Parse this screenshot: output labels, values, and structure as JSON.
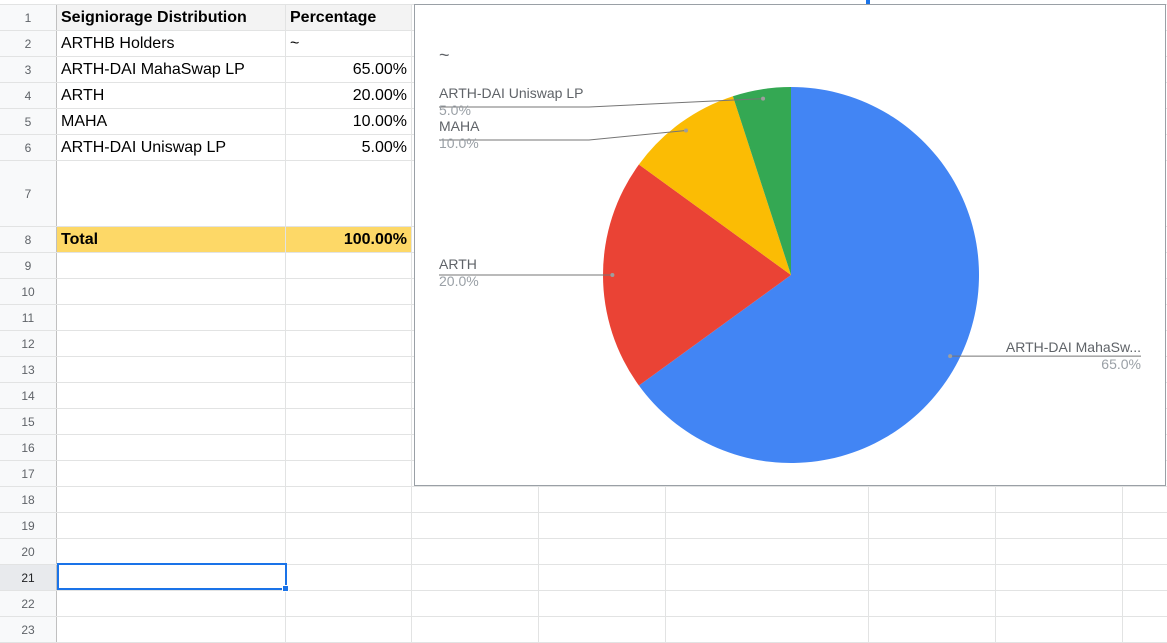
{
  "row_numbers": [
    "1",
    "2",
    "3",
    "4",
    "5",
    "6",
    "7",
    "8",
    "9",
    "10",
    "11",
    "12",
    "13",
    "14",
    "15",
    "16",
    "17",
    "18",
    "19",
    "20",
    "21",
    "22",
    "23"
  ],
  "table": {
    "header": {
      "col_a": "Seigniorage Distribution",
      "col_b": "Percentage"
    },
    "rows": [
      {
        "label": "ARTHB Holders",
        "value": "~"
      },
      {
        "label": "ARTH-DAI MahaSwap LP",
        "value": "65.00%"
      },
      {
        "label": "ARTH",
        "value": "20.00%"
      },
      {
        "label": "MAHA",
        "value": "10.00%"
      },
      {
        "label": "ARTH-DAI Uniswap LP",
        "value": "5.00%"
      }
    ],
    "total": {
      "label": "Total",
      "value": "100.00%"
    }
  },
  "colors": {
    "header_bg": "#f3f3f3",
    "total_bg": "#fdd867",
    "selection": "#1a73e8"
  },
  "chart_data": {
    "type": "pie",
    "title": "~",
    "slices": [
      {
        "label": "ARTH-DAI MahaSw...",
        "percent_label": "65.0%",
        "value": 65,
        "color": "#4285f4"
      },
      {
        "label": "ARTH",
        "percent_label": "20.0%",
        "value": 20,
        "color": "#ea4335"
      },
      {
        "label": "MAHA",
        "percent_label": "10.0%",
        "value": 10,
        "color": "#fbbc04"
      },
      {
        "label": "ARTH-DAI Uniswap LP",
        "percent_label": "5.0%",
        "value": 5,
        "color": "#34a853"
      }
    ]
  }
}
